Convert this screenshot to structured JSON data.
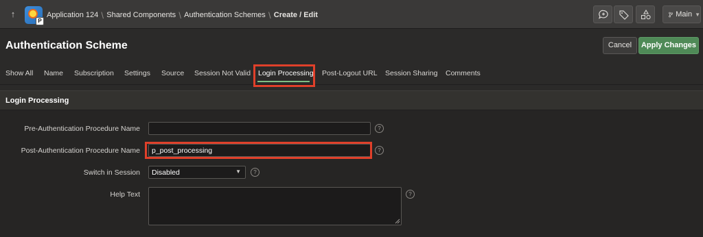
{
  "topbar": {
    "breadcrumbs": [
      {
        "label": "Application 124"
      },
      {
        "label": "Shared Components"
      },
      {
        "label": "Authentication Schemes"
      },
      {
        "label": "Create / Edit"
      }
    ],
    "branch_label": "Main",
    "icons": [
      "up-arrow-icon",
      "app-icon",
      "comment-icon",
      "tag-icon",
      "shapes-icon",
      "branch-icon",
      "chevron-down-icon"
    ]
  },
  "header": {
    "title": "Authentication Scheme",
    "cancel_label": "Cancel",
    "apply_label": "Apply Changes",
    "accent_color": "#4f8a57"
  },
  "tabs": [
    {
      "label": "Show All"
    },
    {
      "label": "Name"
    },
    {
      "label": "Subscription"
    },
    {
      "label": "Settings"
    },
    {
      "label": "Source"
    },
    {
      "label": "Session Not Valid"
    },
    {
      "label": "Login Processing",
      "active": true
    },
    {
      "label": "Post-Logout URL"
    },
    {
      "label": "Session Sharing"
    },
    {
      "label": "Comments"
    }
  ],
  "section": {
    "title": "Login Processing",
    "fields": {
      "pre_auth": {
        "label": "Pre-Authentication Procedure Name",
        "value": ""
      },
      "post_auth": {
        "label": "Post-Authentication Procedure Name",
        "value": "p_post_processing"
      },
      "switch_in_session": {
        "label": "Switch in Session",
        "value": "Disabled"
      },
      "help_text": {
        "label": "Help Text",
        "value": ""
      }
    },
    "help_glyph": "?"
  },
  "highlight_color": "#e0402a"
}
